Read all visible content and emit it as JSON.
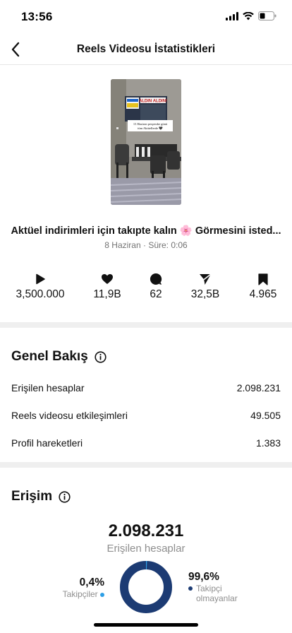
{
  "status": {
    "time": "13:56"
  },
  "nav": {
    "title": "Reels Videosu İstatistikleri"
  },
  "thumbnail": {
    "sign_text": "ALDIN ALDIN!",
    "card_line1": "13 Haziran perşembe günü",
    "card_line2": "tüm Aktüellerde 🖤"
  },
  "reel": {
    "caption": "Aktüel indirimleri için takıpte kalın 🌸 Görmesini isted...",
    "meta": "8 Haziran · Süre: 0:06"
  },
  "stats": [
    {
      "icon": "play-icon",
      "value": "3,500.000"
    },
    {
      "icon": "heart-icon",
      "value": "11,9B"
    },
    {
      "icon": "comment-icon",
      "value": "62"
    },
    {
      "icon": "share-icon",
      "value": "32,5B"
    },
    {
      "icon": "bookmark-icon",
      "value": "4.965"
    }
  ],
  "overview": {
    "title": "Genel Bakış",
    "rows": [
      {
        "label": "Erişilen hesaplar",
        "value": "2.098.231"
      },
      {
        "label": "Reels videosu etkileşimleri",
        "value": "49.505"
      },
      {
        "label": "Profil hareketleri",
        "value": "1.383"
      }
    ]
  },
  "reach": {
    "title": "Erişim",
    "value": "2.098.231",
    "label": "Erişilen hesaplar",
    "followers_pct": "0,4%",
    "followers_label": "Takipçiler",
    "non_followers_pct": "99,6%",
    "non_followers_label_line1": "Takipçi",
    "non_followers_label_line2": "olmayanlar",
    "followers_fraction": 0.004,
    "colors": {
      "followers": "#2e9fe6",
      "non_followers": "#1c3b73"
    }
  }
}
